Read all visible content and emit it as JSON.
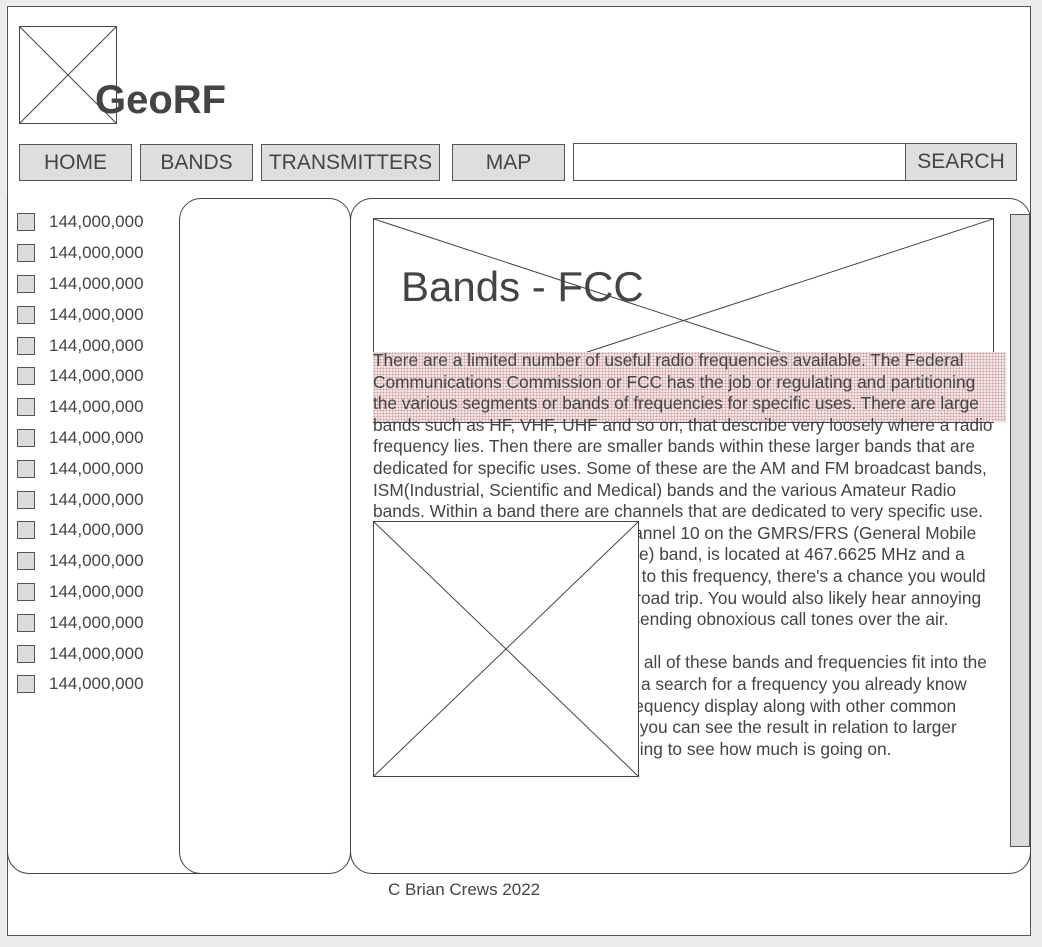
{
  "app": {
    "title": "GeoRF",
    "logo_icon": "image-placeholder-icon"
  },
  "nav": {
    "home_label": "HOME",
    "bands_label": "BANDS",
    "transmitters_label": "TRANSMITTERS",
    "map_label": "MAP",
    "search_value": "",
    "search_label": "SEARCH"
  },
  "frequency_list": [
    "144,000,000",
    "144,000,000",
    "144,000,000",
    "144,000,000",
    "144,000,000",
    "144,000,000",
    "144,000,000",
    "144,000,000",
    "144,000,000",
    "144,000,000",
    "144,000,000",
    "144,000,000",
    "144,000,000",
    "144,000,000",
    "144,000,000",
    "144,000,000"
  ],
  "content": {
    "heading": "Bands - FCC",
    "paragraph_1": "There are a limited number of useful radio frequencies available. The Federal Communications Commission or FCC has the job or regulating and partitioning the various segments or bands of frequencies for specific uses. There are large bands such as HF, VHF, UHF and so on, that describe very loosely where a radio frequency lies. Then there are smaller bands within these larger bands that are dedicated for specific uses. Some of these are the AM and FM broadcast bands, ISM(Industrial, Scientific and Medical) bands and the various Amateur Radio bands. Within a band there are channels that are dedicated to very specific use. For example, what is known as channel 10 on the GMRS/FRS (General Mobile Radio Service/Family Radio Service) band, is located at 467.6625 MHz and a bandwidth of 11khz. If you listened to this frequency, there's a chance you would hear families communicating on a road trip. You would also likely hear annoying amateur broadcasters repeatedly sending obnoxious call tones over the air.",
    "paragraph_2": "GeoRF can help you visualize how all of these bands and frequencies fit into the spectrum of RF frequencies. Enter a search for a frequency you already know about, and it will show up on the frequency display along with other common frequencies nearby. Zoom out and you can see the result in relation to larger bands of frequencies. It’s enlightening to see how much is going on."
  },
  "footer": {
    "text": "C Brian Crews 2022"
  }
}
